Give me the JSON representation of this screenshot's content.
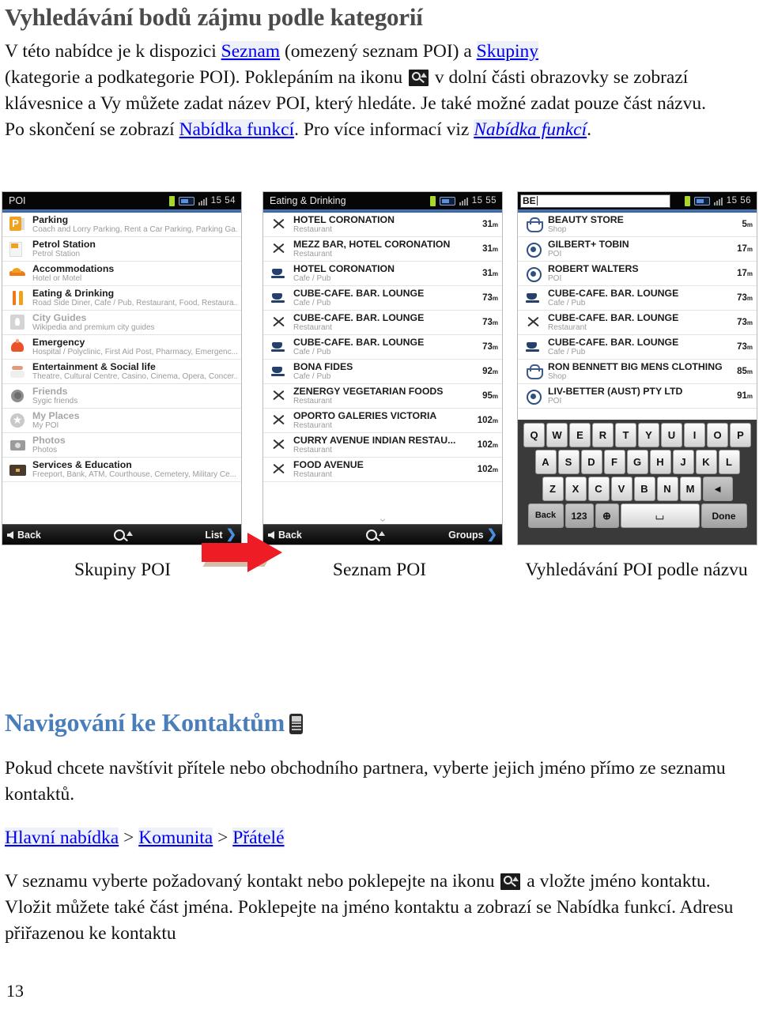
{
  "document": {
    "title": "Vyhledávání bodů zájmu podle kategorií",
    "page_number": "13",
    "intro": {
      "s1": "V této nabídce je k dispozici ",
      "link_seznam": "Seznam",
      "s2": " (omezený seznam POI) a ",
      "link_skupiny": "Skupiny",
      "s3": "(kategorie a podkategorie POI). Poklepáním na ikonu ",
      "s4": " v dolní části obrazovky se zobrazí klávesnice a Vy můžete zadat název POI, který hledáte. Je také možné zadat pouze část názvu.",
      "s5": "Po skončení se zobrazí ",
      "link_nabidka": "Nabídka funkcí",
      "s6": ". Pro více informací viz ",
      "link_nabidka_italic": "Nabídka funkcí",
      "s7": "."
    },
    "section2": {
      "heading": "Navigování ke Kontaktům",
      "p1": "Pokud chcete navštívit přítele nebo obchodního partnera, vyberte jejich jméno přímo ze seznamu kontaktů.",
      "breadcrumb": {
        "item1": "Hlavní nabídka",
        "sep1": " > ",
        "item2": "Komunita",
        "sep2": " > ",
        "item3": "Přátelé"
      },
      "p2a": "V seznamu vyberte požadovaný kontakt nebo poklepejte na ikonu ",
      "p2b": " a vložte jméno kontaktu. Vložit můžete také část jména. Poklepejte na jméno kontaktu a zobrazí se Nabídka funkcí. Adresu přiřazenou ke kontaktu"
    }
  },
  "captions": {
    "c1": "Skupiny POI",
    "c2": "Seznam POI",
    "c3": "Vyhledávání POI podle názvu"
  },
  "screenshot1": {
    "statusbar": {
      "title": "POI",
      "clock": "15 54"
    },
    "rows": [
      {
        "name": "Parking",
        "sub": "Coach and Lorry Parking, Rent a Car Parking, Parking Ga...",
        "icon": "parking-icon",
        "dim": false
      },
      {
        "name": "Petrol Station",
        "sub": "Petrol Station",
        "icon": "petrol-station-icon",
        "dim": false
      },
      {
        "name": "Accommodations",
        "sub": "Hotel or Motel",
        "icon": "accommodation-icon",
        "dim": false
      },
      {
        "name": "Eating & Drinking",
        "sub": "Road Side Diner, Cafe / Pub, Restaurant, Food, Restaura...",
        "icon": "eating-drinking-icon",
        "dim": false
      },
      {
        "name": "City Guides",
        "sub": "Wikipedia and premium city guides",
        "icon": "city-guides-icon",
        "dim": true
      },
      {
        "name": "Emergency",
        "sub": "Hospital / Polyclinic, First Aid Post, Pharmacy, Emergenc...",
        "icon": "emergency-icon",
        "dim": false
      },
      {
        "name": "Entertainment & Social life",
        "sub": "Theatre, Cultural Centre, Casino, Cinema, Opera, Concer...",
        "icon": "entertainment-icon",
        "dim": false
      },
      {
        "name": "Friends",
        "sub": "Sygic friends",
        "icon": "friends-icon",
        "dim": true
      },
      {
        "name": "My Places",
        "sub": "My POI",
        "icon": "my-places-icon",
        "dim": true
      },
      {
        "name": "Photos",
        "sub": "Photos",
        "icon": "photos-icon",
        "dim": true
      },
      {
        "name": "Services & Education",
        "sub": "Freeport, Bank, ATM, Courthouse, Cemetery, Military Ce...",
        "icon": "services-education-icon",
        "dim": false
      }
    ],
    "toolbar": {
      "back": "Back",
      "right": "List"
    }
  },
  "screenshot2": {
    "statusbar": {
      "title": "Eating & Drinking",
      "clock": "15 55"
    },
    "rows": [
      {
        "name": "HOTEL CORONATION",
        "sub": "Restaurant",
        "dist": "31",
        "unit": "m",
        "icon": "fork-knife-icon"
      },
      {
        "name": "MEZZ BAR, HOTEL CORONATION",
        "sub": "Restaurant",
        "dist": "31",
        "unit": "m",
        "icon": "fork-knife-icon"
      },
      {
        "name": "HOTEL CORONATION",
        "sub": "Cafe / Pub",
        "dist": "31",
        "unit": "m",
        "icon": "coffee-cup-icon"
      },
      {
        "name": "CUBE-CAFE. BAR. LOUNGE",
        "sub": "Cafe / Pub",
        "dist": "73",
        "unit": "m",
        "icon": "coffee-cup-icon"
      },
      {
        "name": "CUBE-CAFE. BAR. LOUNGE",
        "sub": "Restaurant",
        "dist": "73",
        "unit": "m",
        "icon": "fork-knife-icon"
      },
      {
        "name": "CUBE-CAFE. BAR. LOUNGE",
        "sub": "Cafe / Pub",
        "dist": "73",
        "unit": "m",
        "icon": "coffee-cup-icon"
      },
      {
        "name": "BONA FIDES",
        "sub": "Cafe / Pub",
        "dist": "92",
        "unit": "m",
        "icon": "coffee-cup-icon"
      },
      {
        "name": "ZENERGY VEGETARIAN FOODS",
        "sub": "Restaurant",
        "dist": "95",
        "unit": "m",
        "icon": "fork-knife-icon"
      },
      {
        "name": "OPORTO GALERIES VICTORIA",
        "sub": "Restaurant",
        "dist": "102",
        "unit": "m",
        "icon": "fork-knife-icon"
      },
      {
        "name": "CURRY AVENUE INDIAN RESTAU...",
        "sub": "Restaurant",
        "dist": "102",
        "unit": "m",
        "icon": "fork-knife-icon"
      },
      {
        "name": "FOOD AVENUE",
        "sub": "Restaurant",
        "dist": "102",
        "unit": "m",
        "icon": "fork-knife-icon"
      }
    ],
    "toolbar": {
      "back": "Back",
      "right": "Groups"
    }
  },
  "screenshot3": {
    "statusbar": {
      "search_value": "BE",
      "clock": "15 56"
    },
    "rows": [
      {
        "name": "BEAUTY STORE",
        "sub": "Shop",
        "dist": "5",
        "unit": "m",
        "icon": "basket-icon"
      },
      {
        "name": "GILBERT+ TOBIN",
        "sub": "POI",
        "dist": "17",
        "unit": "m",
        "icon": "poi-dot-icon"
      },
      {
        "name": "ROBERT WALTERS",
        "sub": "POI",
        "dist": "17",
        "unit": "m",
        "icon": "poi-dot-icon"
      },
      {
        "name": "CUBE-CAFE. BAR. LOUNGE",
        "sub": "Cafe / Pub",
        "dist": "73",
        "unit": "m",
        "icon": "coffee-cup-icon"
      },
      {
        "name": "CUBE-CAFE. BAR. LOUNGE",
        "sub": "Restaurant",
        "dist": "73",
        "unit": "m",
        "icon": "fork-knife-icon"
      },
      {
        "name": "CUBE-CAFE. BAR. LOUNGE",
        "sub": "Cafe / Pub",
        "dist": "73",
        "unit": "m",
        "icon": "coffee-cup-icon"
      },
      {
        "name": "RON BENNETT BIG MENS CLOTHING",
        "sub": "Shop",
        "dist": "85",
        "unit": "m",
        "icon": "basket-icon"
      },
      {
        "name": "LIV-BETTER (AUST) PTY LTD",
        "sub": "POI",
        "dist": "91",
        "unit": "m",
        "icon": "poi-dot-icon"
      }
    ],
    "keyboard": {
      "row1": [
        "Q",
        "W",
        "E",
        "R",
        "T",
        "Y",
        "U",
        "I",
        "O",
        "P"
      ],
      "row2": [
        "A",
        "S",
        "D",
        "F",
        "G",
        "H",
        "J",
        "K",
        "L"
      ],
      "row3": [
        "Z",
        "X",
        "C",
        "V",
        "B",
        "N",
        "M"
      ],
      "backspace": "◄",
      "back": "Back",
      "numeric": "123",
      "globe": "⊕",
      "space": "⌴",
      "done": "Done"
    }
  },
  "colors": {
    "heading_blue": "#4a7ebb",
    "title_gray": "#4b4b4b",
    "arrow_red": "#ee1c25",
    "link_bg": "#eef1f7"
  }
}
